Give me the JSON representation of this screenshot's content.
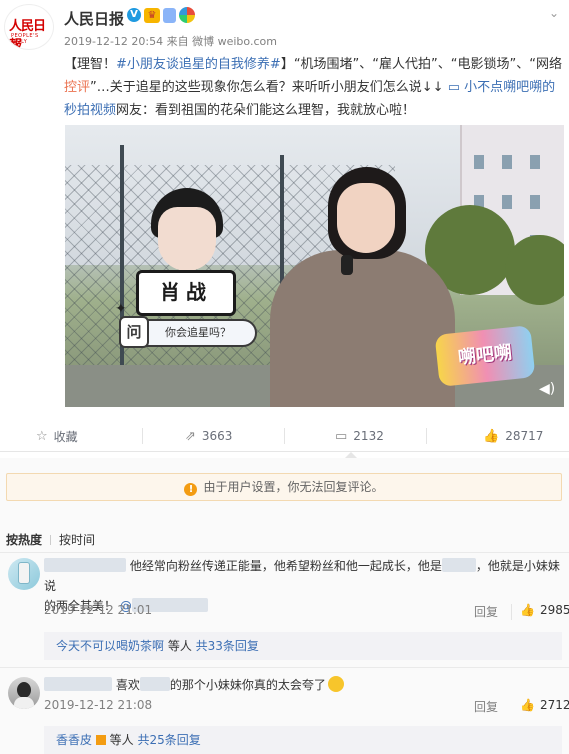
{
  "post": {
    "author": "人民日报",
    "logo_text": "人民日報",
    "logo_en": "PEOPLE'S DAILY",
    "meta": "2019-12-12 20:54 来自 微博 weibo.com",
    "seg1": "【理智！",
    "seg2": "#小朋友谈追星的自我修养#",
    "seg3": "】“机场围堵”、“雇人代拍”、“电影锁场”、“网络",
    "seg4": "控评",
    "seg5": "”…关于追星的这些现象你怎么看？来听听小朋友们怎么说↓↓",
    "seg6": "小不点嗍吧嗍的秒拍视频",
    "seg7": "网友：看到祖国的花朵们能这么理智，我就放心啦！"
  },
  "video": {
    "name_plate": "肖战",
    "question": "你会追星吗？",
    "q_char": "问",
    "show_logo": "嗍吧嗍"
  },
  "actions": {
    "favorite": "收藏",
    "share_count": "3663",
    "comment_count": "2132",
    "like_count": "28717"
  },
  "comments": {
    "notice": "由于用户设置，你无法回复评论。",
    "sort_hot": "按热度",
    "sort_time": "按时间",
    "reply_label": "回复",
    "items": [
      {
        "text_a": "他经常向粉丝传递正能量，他希望粉丝和他一起成长，他是",
        "text_b": "，他就是小妹妹说",
        "text_c": "的两全其美！",
        "time": "2019-12-12 21:01",
        "likes": "2985",
        "sub_user": "今天不可以喝奶茶啊",
        "sub_text": " 等人 ",
        "sub_count": "共33条回复"
      },
      {
        "text_a": "喜欢",
        "text_b": "的那个小妹妹你真的太会夸了",
        "time": "2019-12-12 21:08",
        "likes": "2712",
        "sub_user": "香香皮",
        "sub_text": " 等人 ",
        "sub_count": "共25条回复"
      }
    ]
  },
  "colors": {
    "accent": "#eb7350",
    "link": "#3c6fb4",
    "vip": "#1f9ae0"
  }
}
